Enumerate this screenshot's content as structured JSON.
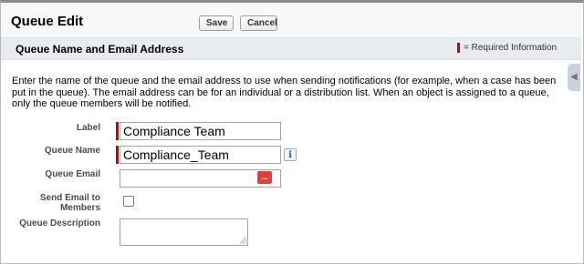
{
  "header": {
    "title": "Queue Edit",
    "save_label": "Save",
    "cancel_label": "Cancel"
  },
  "section": {
    "title": "Queue Name and Email Address",
    "required_info": "= Required Information"
  },
  "intro_text": "Enter the name of the queue and the email address to use when sending notifications (for example, when a case has been put in the queue). The email address can be for an individual or a distribution list. When an object is assigned to a queue, only the queue members will be notified.",
  "fields": {
    "label": {
      "label": "Label",
      "value": "Compliance Team",
      "required": true
    },
    "queue_name": {
      "label": "Queue Name",
      "value": "Compliance_Team",
      "required": true,
      "info_icon": "i"
    },
    "queue_email": {
      "label": "Queue Email",
      "value": "",
      "icon": "..."
    },
    "send_email": {
      "label": "Send Email to Members",
      "checked": false
    },
    "description": {
      "label": "Queue Description",
      "value": ""
    }
  },
  "colors": {
    "required_marker": "#cc0000",
    "section_bar": "#e8ebf0",
    "email_icon": "#e0403a"
  }
}
